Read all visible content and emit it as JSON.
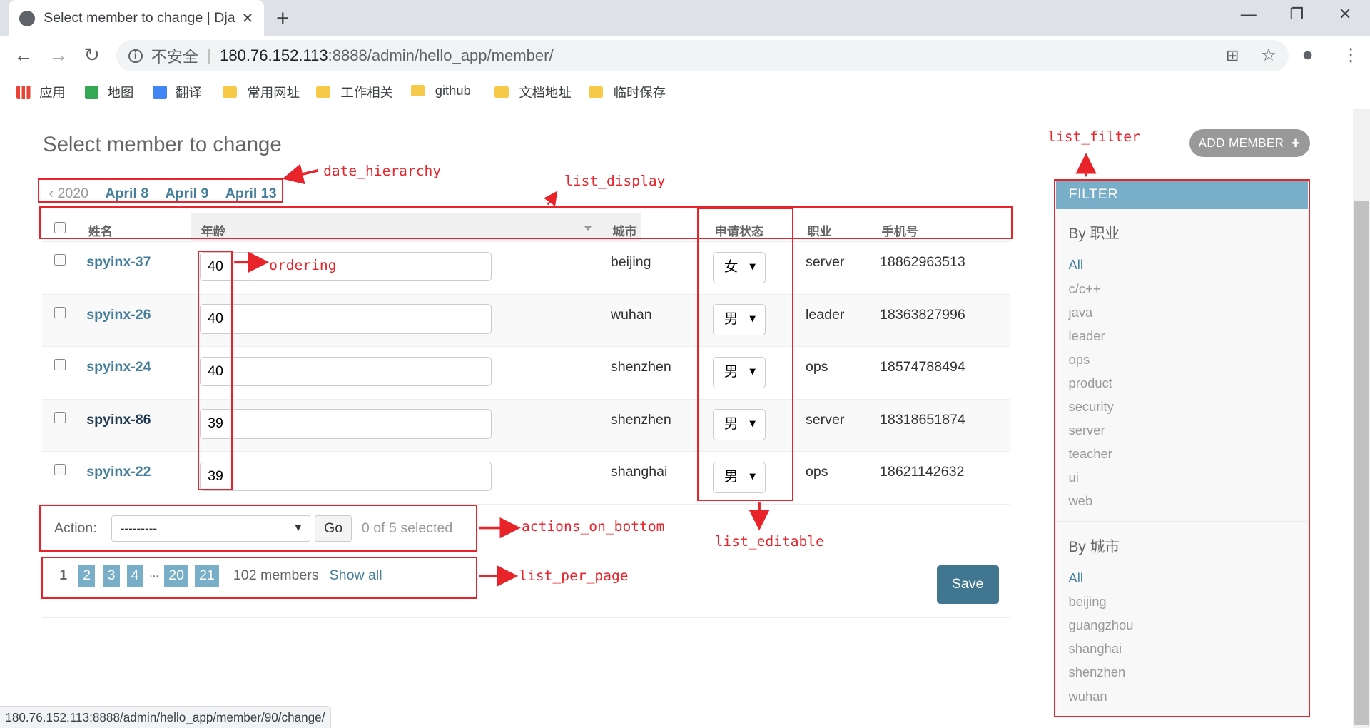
{
  "browser": {
    "tab_title": "Select member to change | Django",
    "insecure_label": "不安全",
    "url_host": "180.76.152.113",
    "url_path": ":8888/admin/hello_app/member/",
    "bookmarks": [
      "应用",
      "地图",
      "翻译",
      "常用网址",
      "工作相关",
      "github",
      "文档地址",
      "临时保存"
    ],
    "status_url": "180.76.152.113:8888/admin/hello_app/member/90/change/"
  },
  "page": {
    "title": "Select member to change",
    "add_button": "ADD MEMBER",
    "date_back": "‹ 2020",
    "dates": [
      "April 8",
      "April 9",
      "April 13"
    ]
  },
  "table": {
    "columns": [
      "姓名",
      "年龄",
      "城市",
      "申请状态",
      "职业",
      "手机号"
    ],
    "rows": [
      {
        "name": "spyinx-37",
        "age": "40",
        "city": "beijing",
        "status": "女",
        "job": "server",
        "phone": "18862963513"
      },
      {
        "name": "spyinx-26",
        "age": "40",
        "city": "wuhan",
        "status": "男",
        "job": "leader",
        "phone": "18363827996"
      },
      {
        "name": "spyinx-24",
        "age": "40",
        "city": "shenzhen",
        "status": "男",
        "job": "ops",
        "phone": "18574788494"
      },
      {
        "name": "spyinx-86",
        "age": "39",
        "city": "shenzhen",
        "status": "男",
        "job": "server",
        "phone": "18318651874"
      },
      {
        "name": "spyinx-22",
        "age": "39",
        "city": "shanghai",
        "status": "男",
        "job": "ops",
        "phone": "18621142632"
      }
    ]
  },
  "actions": {
    "label": "Action:",
    "selected_option": "---------",
    "go": "Go",
    "count": "0 of 5 selected"
  },
  "pagination": {
    "current": "1",
    "pages": [
      "2",
      "3",
      "4",
      "20",
      "21"
    ],
    "ellipsis": "...",
    "total": "102 members",
    "show_all": "Show all",
    "save": "Save"
  },
  "filter": {
    "title": "FILTER",
    "groups": [
      {
        "title": "By 职业",
        "options": [
          "All",
          "c/c++",
          "java",
          "leader",
          "ops",
          "product",
          "security",
          "server",
          "teacher",
          "ui",
          "web"
        ]
      },
      {
        "title": "By 城市",
        "options": [
          "All",
          "beijing",
          "guangzhou",
          "shanghai",
          "shenzhen",
          "wuhan"
        ]
      }
    ]
  },
  "annotations": {
    "list_filter": "list_filter",
    "date_hierarchy": "date_hierarchy",
    "list_display": "list_display",
    "ordering": "ordering",
    "actions_on_bottom": "actions_on_bottom",
    "list_editable": "list_editable",
    "list_per_page": "list_per_page"
  },
  "colors": {
    "annotation": "#e8232a",
    "accent": "#79aec8",
    "link": "#447e9b",
    "save": "#417690"
  }
}
